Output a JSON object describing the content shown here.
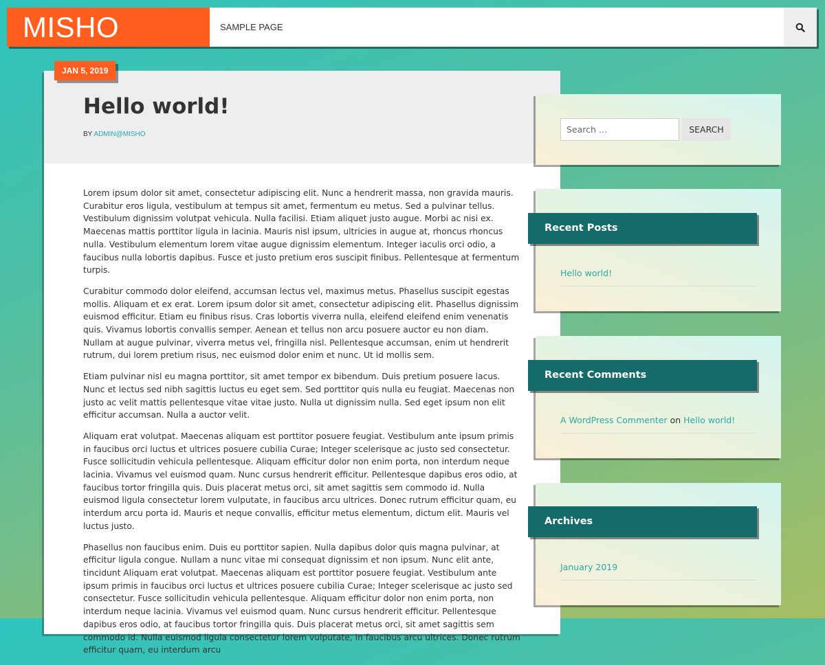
{
  "header": {
    "logo": "MISHO",
    "nav": [
      "SAMPLE PAGE"
    ],
    "search_icon": "search-icon",
    "accent_color": "#ff5e1f"
  },
  "post": {
    "date": "JAN 5, 2019",
    "title": "Hello world!",
    "by_label": "BY",
    "author": "ADMIN@MISHO",
    "paragraphs": [
      "Lorem ipsum dolor sit amet, consectetur adipiscing elit. Nunc a hendrerit massa, non gravida mauris. Curabitur eros ligula, vestibulum at tempus sit amet, fermentum eu metus. Sed a pulvinar tellus. Vestibulum dignissim volutpat vehicula. Nulla facilisi. Etiam aliquet justo augue. Morbi ac nisi ex. Maecenas mattis porttitor ligula in lacinia. Mauris nisl ipsum, ultricies in augue at, rhoncus rhoncus nulla. Vestibulum elementum lorem vitae augue dignissim elementum. Integer iaculis orci odio, a faucibus nulla lobortis dapibus. Fusce et justo pretium eros suscipit finibus. Pellentesque at fermentum turpis.",
      "Curabitur commodo dolor eleifend, accumsan lectus vel, maximus metus. Phasellus suscipit egestas mollis. Aliquam et ex erat. Lorem ipsum dolor sit amet, consectetur adipiscing elit. Phasellus dignissim euismod efficitur. Etiam eu finibus risus. Cras lobortis viverra nulla, eleifend eleifend enim venenatis quis. Vivamus lobortis convallis semper. Aenean et tellus non arcu posuere auctor eu non diam. Nullam at augue pulvinar, viverra metus vel, fringilla nisl. Pellentesque accumsan, enim ut hendrerit rutrum, dui lorem pretium risus, nec euismod dolor enim et nunc. Ut id mollis sem.",
      "Etiam pulvinar nisl eu magna porttitor, sit amet tempor ex bibendum. Duis pretium posuere lacus. Nunc et lectus sed nibh sagittis luctus eu eget sem. Sed porttitor quis nulla eu feugiat. Maecenas non justo ac velit mattis pellentesque vitae vitae justo. Nulla ut dignissim nulla. Sed eget ipsum non elit efficitur accumsan. Nulla a auctor velit.",
      "Aliquam erat volutpat. Maecenas aliquam est porttitor posuere feugiat. Vestibulum ante ipsum primis in faucibus orci luctus et ultrices posuere cubilia Curae; Integer scelerisque ac justo sed consectetur. Fusce sollicitudin vehicula pellentesque. Aliquam efficitur dolor non enim porta, non interdum neque lacinia. Vivamus vel euismod quam. Nunc cursus hendrerit efficitur. Pellentesque dapibus eros odio, at faucibus tortor fringilla quis. Duis placerat metus orci, sit amet sagittis sem commodo id. Nulla euismod ligula consectetur lorem vulputate, in faucibus arcu ultrices. Donec rutrum efficitur quam, eu interdum arcu porta id. Mauris et neque convallis, efficitur metus elementum, dictum elit. Mauris vel luctus justo.",
      "Phasellus non faucibus enim. Duis eu porttitor sapien. Nulla dapibus dolor quis magna pulvinar, at efficitur ligula congue. Nullam a nunc vitae mi consequat dignissim et non ipsum. Nunc elit ante, tincidunt Aliquam erat volutpat. Maecenas aliquam est porttitor posuere feugiat. Vestibulum ante ipsum primis in faucibus orci luctus et ultrices posuere cubilia Curae; Integer scelerisque ac justo sed consectetur. Fusce sollicitudin vehicula pellentesque. Aliquam efficitur dolor non enim porta, non interdum neque lacinia. Vivamus vel euismod quam. Nunc cursus hendrerit efficitur. Pellentesque dapibus eros odio, at faucibus tortor fringilla quis. Duis placerat metus orci, sit amet sagittis sem commodo id. Nulla euismod ligula consectetur lorem vulputate, in faucibus arcu ultrices. Donec rutrum efficitur quam, eu interdum arcu"
    ]
  },
  "sidebar": {
    "search": {
      "placeholder": "Search …",
      "button": "SEARCH"
    },
    "recent_posts": {
      "title": "Recent Posts",
      "items": [
        "Hello world!"
      ]
    },
    "recent_comments": {
      "title": "Recent Comments",
      "author": "A WordPress Commenter",
      "on": "on",
      "post": "Hello world!"
    },
    "archives": {
      "title": "Archives",
      "items": [
        "January 2019"
      ]
    },
    "widget_title_color": "#146b69",
    "link_color": "#2aa8a8"
  }
}
